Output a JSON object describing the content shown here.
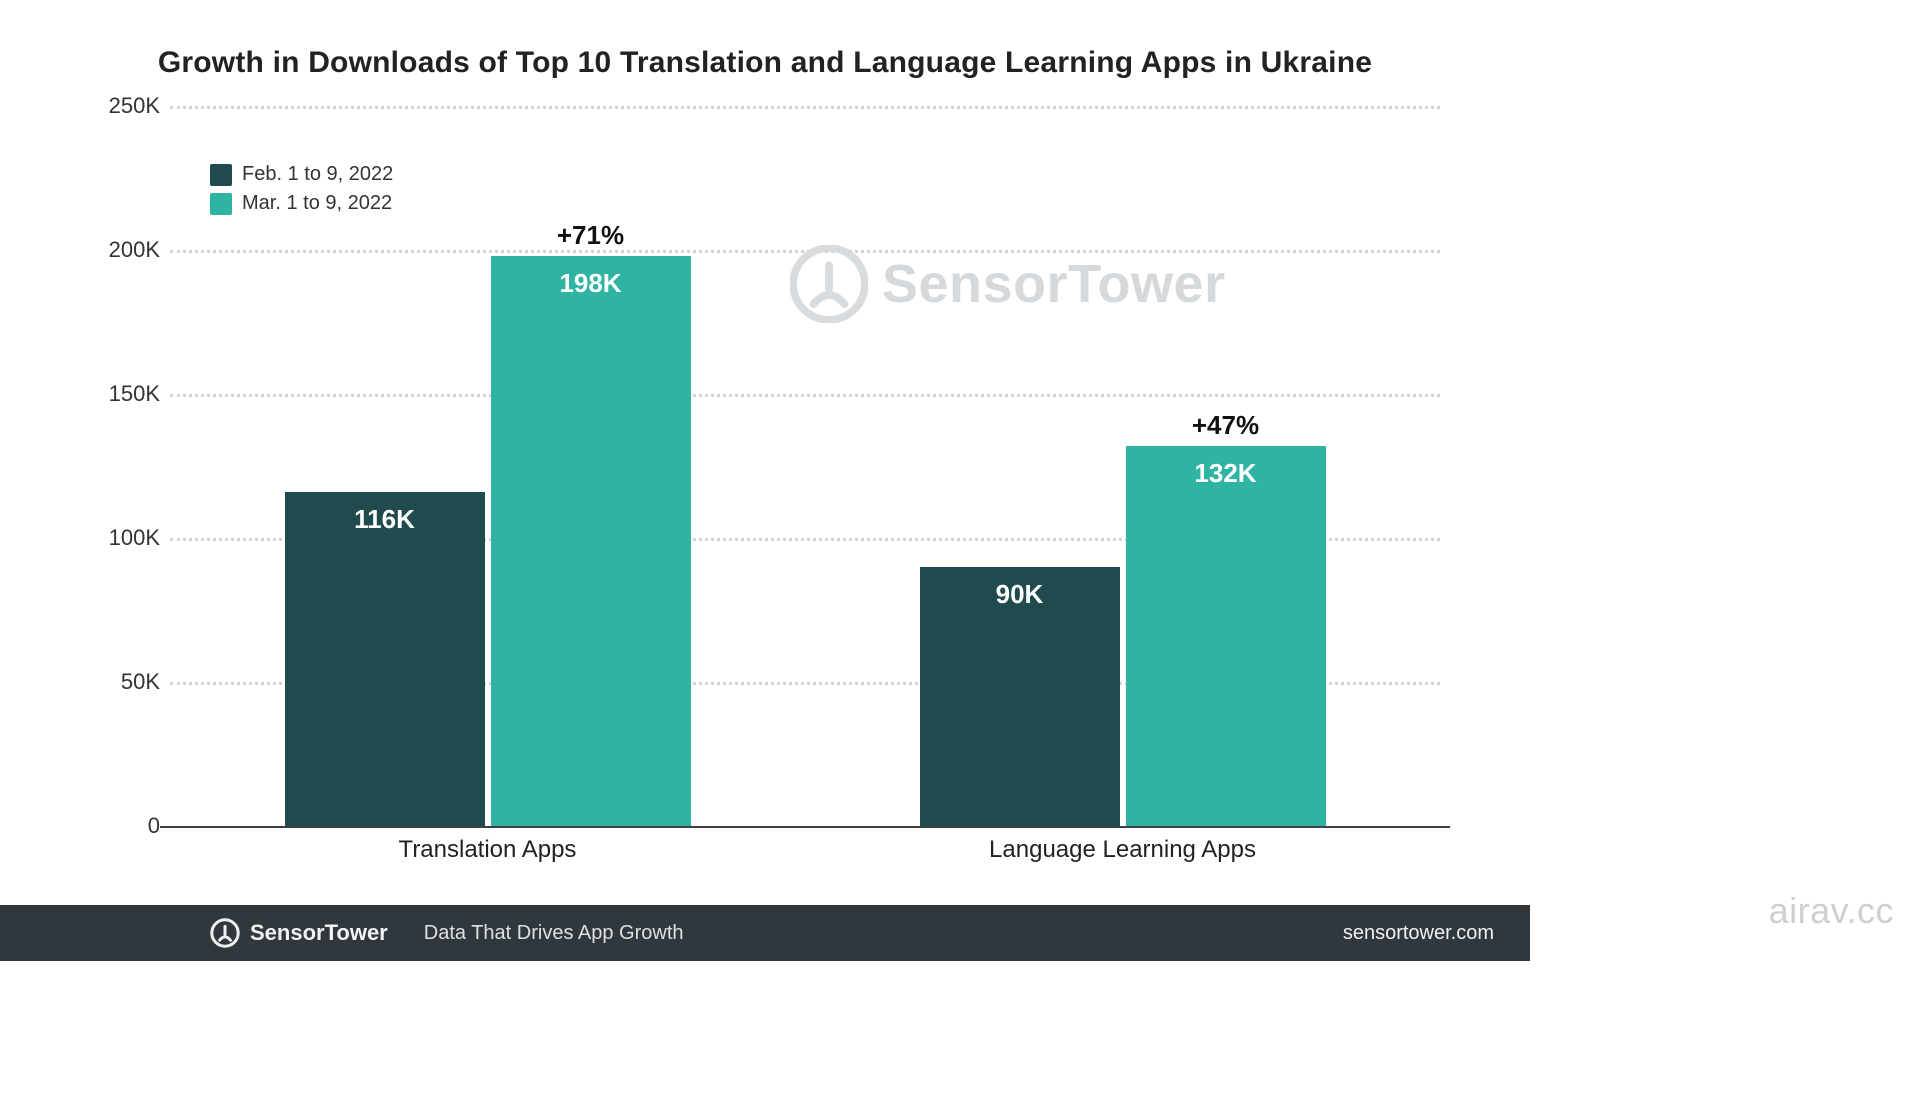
{
  "chart_data": {
    "type": "bar",
    "title": "Growth in Downloads of Top 10 Translation and Language Learning Apps in Ukraine",
    "categories": [
      "Translation Apps",
      "Language Learning Apps"
    ],
    "series": [
      {
        "name": "Feb. 1 to 9, 2022",
        "color": "#1f4a4e",
        "values": [
          116000,
          90000
        ],
        "value_labels": [
          "116K",
          "90K"
        ]
      },
      {
        "name": "Mar. 1 to 9, 2022",
        "color": "#2fb3a3",
        "values": [
          198000,
          132000
        ],
        "value_labels": [
          "198K",
          "132K"
        ],
        "growth_labels": [
          "+71%",
          "+47%"
        ]
      }
    ],
    "xlabel": "",
    "ylabel": "",
    "ylim": [
      0,
      250000
    ],
    "yticks": [
      0,
      50000,
      100000,
      150000,
      200000,
      250000
    ],
    "ytick_labels": [
      "0",
      "50K",
      "100K",
      "150K",
      "200K",
      "250K"
    ],
    "legend_position": "top-left",
    "grid": true
  },
  "watermark": {
    "text": "SensorTower"
  },
  "footer": {
    "brand": "SensorTower",
    "tagline": "Data That Drives App Growth",
    "site": "sensortower.com"
  },
  "page_watermark": "airav.cc"
}
